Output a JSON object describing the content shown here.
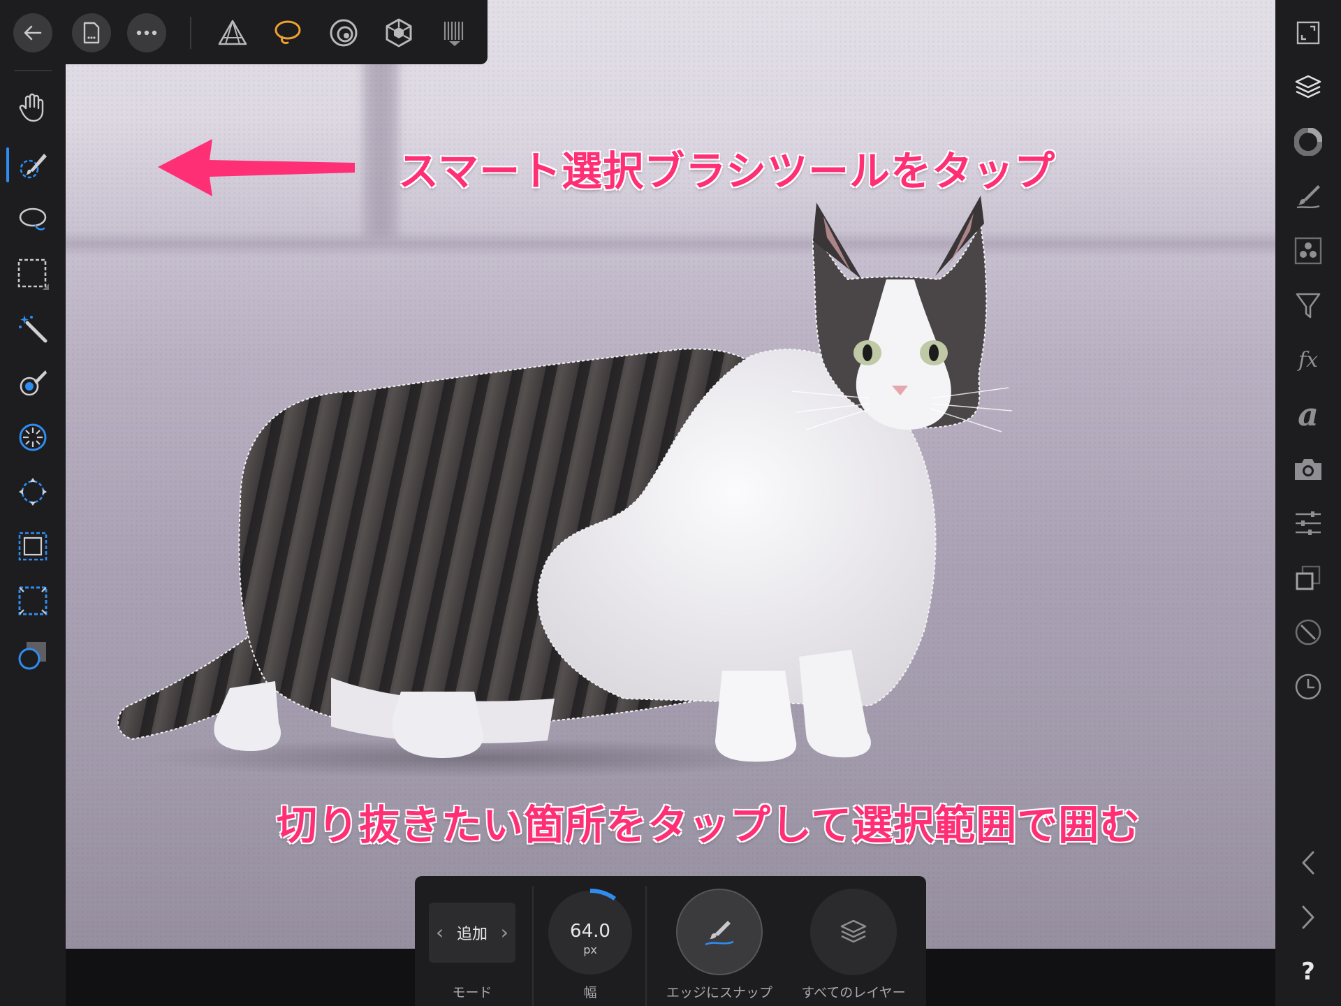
{
  "annotations": {
    "top": "スマート選択ブラシツールをタップ",
    "bottom": "切り抜きたい箇所をタップして選択範囲で囲む"
  },
  "top_toolbar": {
    "buttons": [
      "back-icon",
      "document-icon",
      "more-icon"
    ],
    "personas": [
      "photo-persona-icon",
      "liquify-persona-icon",
      "develop-persona-icon",
      "tone-mapping-persona-icon",
      "export-persona-icon"
    ],
    "active_persona": "liquify-persona-icon",
    "active_color": "#f0a030"
  },
  "left_tools": {
    "tools": [
      "view-tool-icon",
      "selection-brush-tool-icon",
      "freehand-selection-tool-icon",
      "rectangular-marquee-tool-icon",
      "flood-select-tool-icon",
      "refine-selection-icon",
      "radial-selection-icon",
      "transform-selection-icon",
      "expand-selection-icon",
      "contract-selection-icon",
      "quick-mask-icon"
    ],
    "active_tool": "selection-brush-tool-icon",
    "accent": "#2f8cf0"
  },
  "right_studio": {
    "panels": [
      "fullscreen-icon",
      "layers-icon",
      "color-icon",
      "brushes-icon",
      "channels-icon",
      "filter-icon",
      "fx-icon",
      "text-style-icon",
      "camera-icon",
      "adjustments-icon",
      "transform-icon",
      "navigator-icon",
      "history-icon"
    ],
    "fx_text": "fx",
    "text_style_text": "a",
    "bottom_controls": [
      "chevron-left-icon",
      "chevron-right-icon",
      "help-icon"
    ],
    "help_text": "?"
  },
  "context_toolbar": {
    "mode": {
      "value": "追加",
      "label": "モード"
    },
    "width": {
      "value": "64.0",
      "unit": "px",
      "label": "幅",
      "dial_fraction": 0.1
    },
    "snap_edges": {
      "label": "エッジにスナップ",
      "active": true
    },
    "all_layers": {
      "label": "すべてのレイヤー",
      "active": false
    }
  }
}
